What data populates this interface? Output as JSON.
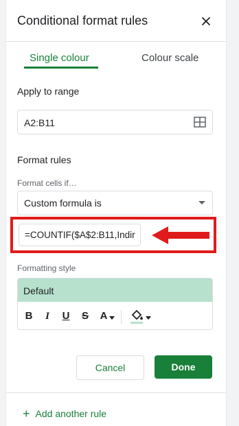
{
  "panel": {
    "title": "Conditional format rules",
    "close_icon": "close-icon"
  },
  "tabs": [
    {
      "label": "Single colour",
      "active": true
    },
    {
      "label": "Colour scale",
      "active": false
    }
  ],
  "range": {
    "label": "Apply to range",
    "value": "A2:B11",
    "icon": "select-range-grid-icon"
  },
  "format_rules": {
    "label": "Format rules",
    "condition_label": "Format cells if…",
    "condition_value": "Custom formula is",
    "formula_value": "=COUNTIF($A$2:B11,Indir"
  },
  "annotation": {
    "highlight_color": "#e01b1b",
    "arrow_icon": "arrow-left-icon"
  },
  "formatting_style": {
    "label": "Formatting style",
    "preview_text": "Default",
    "preview_color": "#b7e1cd",
    "buttons": {
      "bold": "B",
      "italic": "I",
      "underline": "U",
      "strikethrough": "S",
      "text_color": "A"
    }
  },
  "actions": {
    "cancel": "Cancel",
    "done": "Done",
    "add_rule_icon": "+",
    "add_rule": "Add another rule"
  },
  "colors": {
    "accent": "#188038"
  }
}
